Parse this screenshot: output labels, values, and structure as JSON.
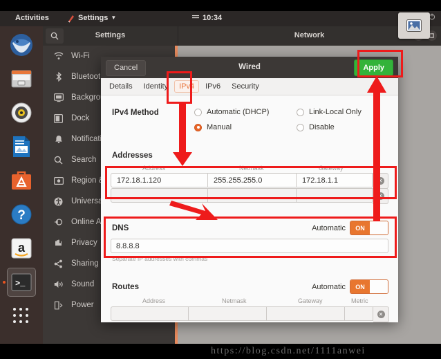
{
  "topbar": {
    "activities": "Activities",
    "app_menu": "Settings",
    "app_menu_caret": "▼",
    "clock": "10:34",
    "clock_icon": "menu-lines-icon",
    "sys_icons": [
      "network-icon",
      "volume-icon",
      "power-icon"
    ]
  },
  "floating_popup": {
    "icon": "image-preview-icon"
  },
  "dock": {
    "items": [
      {
        "name": "thunderbird",
        "label": "Thunderbird Mail",
        "active": false
      },
      {
        "name": "files",
        "label": "Files",
        "active": false
      },
      {
        "name": "rhythmbox",
        "label": "Rhythmbox",
        "active": false
      },
      {
        "name": "libreoffice-writer",
        "label": "LibreOffice Writer",
        "active": false
      },
      {
        "name": "ubuntu-software",
        "label": "Ubuntu Software",
        "active": false
      },
      {
        "name": "help",
        "label": "Help",
        "active": false
      },
      {
        "name": "amazon",
        "label": "Amazon",
        "active": false
      },
      {
        "name": "terminal",
        "label": "Terminal",
        "active": true
      }
    ],
    "show_apps_label": "Show Applications"
  },
  "settings_window": {
    "search_icon": "search-icon",
    "sidebar_title": "Settings",
    "page_title": "Network",
    "window_controls": [
      "minimize",
      "maximize"
    ],
    "sidebar_items": [
      {
        "label": "Wi-Fi",
        "icon": "wifi-icon"
      },
      {
        "label": "Bluetooth",
        "icon": "bluetooth-icon"
      },
      {
        "label": "Background",
        "icon": "background-icon"
      },
      {
        "label": "Dock",
        "icon": "dock-icon"
      },
      {
        "label": "Notifications",
        "icon": "bell-icon"
      },
      {
        "label": "Search",
        "icon": "search-icon"
      },
      {
        "label": "Region & Language",
        "icon": "region-icon"
      },
      {
        "label": "Universal Access",
        "icon": "accessibility-icon"
      },
      {
        "label": "Online Accounts",
        "icon": "online-accounts-icon"
      },
      {
        "label": "Privacy",
        "icon": "privacy-icon"
      },
      {
        "label": "Sharing",
        "icon": "sharing-icon"
      },
      {
        "label": "Sound",
        "icon": "sound-icon"
      },
      {
        "label": "Power",
        "icon": "power-icon"
      }
    ],
    "add_buttons": [
      "+",
      "+"
    ]
  },
  "dialog": {
    "cancel_label": "Cancel",
    "title": "Wired",
    "apply_label": "Apply",
    "tabs": [
      {
        "label": "Details",
        "selected": false
      },
      {
        "label": "Identity",
        "selected": false
      },
      {
        "label": "IPv4",
        "selected": true
      },
      {
        "label": "IPv6",
        "selected": false
      },
      {
        "label": "Security",
        "selected": false
      }
    ],
    "ipv4_method": {
      "label": "IPv4 Method",
      "options": [
        {
          "label": "Automatic (DHCP)",
          "selected": false
        },
        {
          "label": "Manual",
          "selected": true
        },
        {
          "label": "Link-Local Only",
          "selected": false
        },
        {
          "label": "Disable",
          "selected": false
        }
      ]
    },
    "addresses": {
      "title": "Addresses",
      "columns": [
        "Address",
        "Netmask",
        "Gateway"
      ],
      "rows": [
        {
          "address": "172.18.1.120",
          "netmask": "255.255.255.0",
          "gateway": "172.18.1.1"
        },
        {
          "address": "",
          "netmask": "",
          "gateway": ""
        }
      ],
      "delete_icon": "remove-icon"
    },
    "dns": {
      "title": "DNS",
      "automatic_label": "Automatic",
      "toggle_state": "ON",
      "value": "8.8.8.8",
      "hint": "Separate IP addresses with commas"
    },
    "routes": {
      "title": "Routes",
      "automatic_label": "Automatic",
      "toggle_state": "ON",
      "columns": [
        "Address",
        "Netmask",
        "Gateway",
        "Metric"
      ],
      "rows": [
        {
          "address": "",
          "netmask": "",
          "gateway": "",
          "metric": ""
        }
      ],
      "delete_icon": "remove-icon"
    }
  },
  "annotations": {
    "color": "#ee1b1b",
    "boxes": [
      "ipv4-tab",
      "apply-button",
      "addresses-table",
      "dns-section"
    ],
    "arrows": [
      "arrow-to-addresses",
      "arrow-to-dns",
      "arrow-to-apply"
    ]
  },
  "watermark": {
    "text": "https://blog.csdn.net/1111anwei"
  }
}
